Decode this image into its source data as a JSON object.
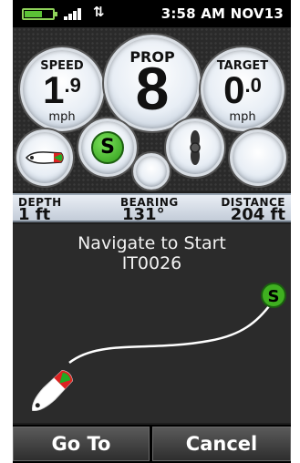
{
  "status": {
    "time": "3:58 AM",
    "date": "NOV13",
    "arrows": "⇅"
  },
  "gauges": {
    "speed": {
      "label": "SPEED",
      "value_int": "1",
      "value_dec": "9",
      "unit": "mph"
    },
    "prop": {
      "label": "PROP",
      "value": "8"
    },
    "target": {
      "label": "TARGET",
      "value_int": "0",
      "value_dec": "0",
      "unit": "mph"
    },
    "start_badge": "S"
  },
  "info": {
    "depth": {
      "label": "DEPTH",
      "value": "1 ft"
    },
    "bearing": {
      "label": "BEARING",
      "value": "131°"
    },
    "distance": {
      "label": "DISTANCE",
      "value": "204 ft"
    }
  },
  "nav": {
    "title_line1": "Navigate to Start",
    "title_line2": "IT0026",
    "target_badge": "S"
  },
  "buttons": {
    "goto": "Go To",
    "cancel": "Cancel"
  },
  "colors": {
    "accent_green": "#3fb020",
    "background": "#2b2b2b",
    "dial_face": "#e8eef5"
  }
}
